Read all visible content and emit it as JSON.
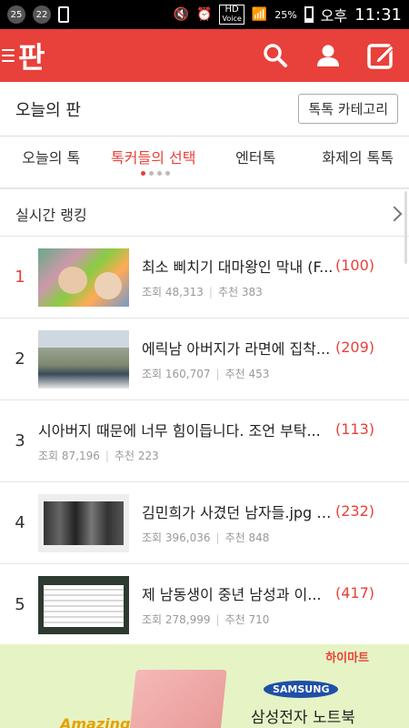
{
  "status_bar": {
    "left_badge_1": "25",
    "left_badge_2": "22",
    "hd": "HD",
    "voice": "Voice",
    "battery": "25%",
    "ampm": "오후",
    "time": "11:31"
  },
  "header": {
    "logo": "판",
    "icons": [
      "menu-icon",
      "search-icon",
      "profile-icon",
      "write-icon"
    ]
  },
  "page": {
    "title": "오늘의 판",
    "category_button": "톡톡 카테고리"
  },
  "tabs": [
    {
      "label": "오늘의 톡",
      "active": false
    },
    {
      "label": "톡커들의 선택",
      "active": true
    },
    {
      "label": "엔터톡",
      "active": false
    },
    {
      "label": "화제의 톡톡",
      "active": false
    }
  ],
  "ranking": {
    "title": "실시간 랭킹",
    "items": [
      {
        "rank": "1",
        "title": "최소 삐치기 대마왕인 막내 (F...",
        "views": "조회 48,313",
        "recs": "추천 383",
        "comments": "(100)"
      },
      {
        "rank": "2",
        "title": "에릭남 아버지가 라면에 집착...",
        "views": "조회 160,707",
        "recs": "추천 453",
        "comments": "(209)"
      },
      {
        "rank": "3",
        "title": "시아버지 때문에 너무 힘이듭니다. 조언 부탁...",
        "views": "조회 87,196",
        "recs": "추천 223",
        "comments": "(113)"
      },
      {
        "rank": "4",
        "title": "김민희가 사겼던 남자들.jpg (...",
        "views": "조회 396,036",
        "recs": "추천 848",
        "comments": "(232)"
      },
      {
        "rank": "5",
        "title": "제 남동생이 중년 남성과 이...",
        "views": "조회 278,999",
        "recs": "추천 710",
        "comments": "(417)"
      }
    ]
  },
  "ad": {
    "brand": "하이마트",
    "samsung": "SAMSUNG",
    "text": "삼성전자 노트북",
    "amazing": "Amazing"
  },
  "colors": {
    "accent": "#e8403a",
    "ad_bg": "#e6f3c5"
  }
}
